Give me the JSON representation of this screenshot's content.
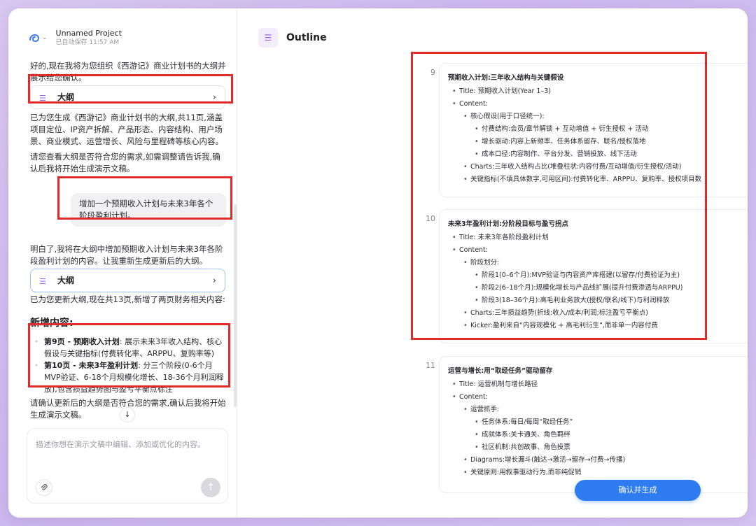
{
  "project": {
    "name": "Unnamed Project",
    "saved": "已自动保存 11:57 AM"
  },
  "chat": {
    "msg1": "好的,现在我将为您组织《西游记》商业计划书的大纲并展示给您确认。",
    "card1_label": "大纲",
    "msg2": "已为您生成《西游记》商业计划书的大纲,共11页,涵盖项目定位、IP资产拆解、产品形态、内容结构、用户场景、商业模式、运营增长、风险与里程碑等核心内容。",
    "msg3": "请您查看大纲是否符合您的需求,如需调整请告诉我,确认后我将开始生成演示文稿。",
    "user_msg": "增加一个预期收入计划与未来3年各个阶段盈利计划。",
    "msg4": "明白了,我将在大纲中增加预期收入计划与未来3年各阶段盈利计划的内容。让我重新生成更新后的大纲。",
    "card2_label": "大纲",
    "msg5": "已为您更新大纲,现在共13页,新增了两页财务相关内容:",
    "new_heading": "新增内容:",
    "new_items": [
      {
        "bold": "第9页 - 预期收入计划",
        "text": ": 展示未来3年收入结构、核心假设与关键指标(付费转化率、ARPPU、复购率等)"
      },
      {
        "bold": "第10页 - 未来3年盈利计划",
        "text": ": 分三个阶段(0-6个月MVP验证、6-18个月规模化增长、18-36个月利润释放),包含损益趋势图与盈亏平衡点标注"
      }
    ],
    "msg6": "请确认更新后的大纲是否符合您的需求,确认后我将开始生成演示文稿。",
    "composer_placeholder": "描述你想在演示文稿中编辑、添加或优化的内容。"
  },
  "outline": {
    "title": "Outline",
    "slides": [
      {
        "num": "9",
        "title": "预期收入计划:三年收入结构与关键假设",
        "lines": [
          {
            "lvl": 1,
            "t": "Title: 预期收入计划(Year 1–3)"
          },
          {
            "lvl": 1,
            "t": "Content:"
          },
          {
            "lvl": 2,
            "t": "核心假设(用于口径统一):"
          },
          {
            "lvl": 3,
            "t": "付费结构:会员/章节解锁 + 互动增值 + 衍生授权 + 活动"
          },
          {
            "lvl": 3,
            "t": "增长驱动:内容上新频率、任务体系留存、联名/授权落地"
          },
          {
            "lvl": 3,
            "t": "成本口径:内容制作、平台分发、营销投放、线下活动"
          },
          {
            "lvl": 2,
            "t": "Charts:三年收入结构占比(堆叠柱状:内容付费/互动增值/衍生授权/活动)"
          },
          {
            "lvl": 2,
            "t": "关键指标(不填具体数字,可用区间):付费转化率、ARPPU、复购率、授权项目数"
          }
        ]
      },
      {
        "num": "10",
        "title": "未来3年盈利计划:分阶段目标与盈亏拐点",
        "lines": [
          {
            "lvl": 1,
            "t": "Title: 未来3年各阶段盈利计划"
          },
          {
            "lvl": 1,
            "t": "Content:"
          },
          {
            "lvl": 2,
            "t": "阶段划分:"
          },
          {
            "lvl": 3,
            "t": "阶段1(0–6个月):MVP验证与内容资产库搭建(以留存/付费验证为主)"
          },
          {
            "lvl": 3,
            "t": "阶段2(6–18个月):规模化增长与产品线扩展(提升付费渗透与ARPPU)"
          },
          {
            "lvl": 3,
            "t": "阶段3(18–36个月):高毛利业务放大(授权/联名/线下)与利润释放"
          },
          {
            "lvl": 2,
            "t": "Charts:三年损益趋势(折线:收入/成本/利润;标注盈亏平衡点)"
          },
          {
            "lvl": 2,
            "t": "Kicker:盈利来自“内容规模化 + 高毛利衍生”,而非单一内容付费"
          }
        ]
      },
      {
        "num": "11",
        "title": "运营与增长:用“取经任务”驱动留存",
        "lines": [
          {
            "lvl": 1,
            "t": "Title: 运营机制与增长路径"
          },
          {
            "lvl": 1,
            "t": "Content:"
          },
          {
            "lvl": 2,
            "t": "运营抓手:"
          },
          {
            "lvl": 3,
            "t": "任务体系:每日/每周“取经任务”"
          },
          {
            "lvl": 3,
            "t": "成就体系:关卡通关、角色羁绊"
          },
          {
            "lvl": 3,
            "t": "社区机制:共创故事、角色投票"
          },
          {
            "lvl": 2,
            "t": "Diagrams:增长漏斗(触达→激活→留存→付费→传播)"
          },
          {
            "lvl": 2,
            "t": "关键原则:用叙事驱动行为,而非纯促销"
          }
        ]
      }
    ],
    "confirm_label": "确认并生成"
  },
  "icons": {
    "logo": "swirl-logo-icon",
    "outline": "outline-list-icon",
    "chevron": "chevron-right-icon",
    "attach": "paperclip-icon",
    "send": "arrow-up-icon",
    "scroll": "arrow-down-icon"
  },
  "colors": {
    "accent": "#2f7cf1",
    "icon_purple": "#9b63e8",
    "annotation_red": "#e02b2b"
  }
}
